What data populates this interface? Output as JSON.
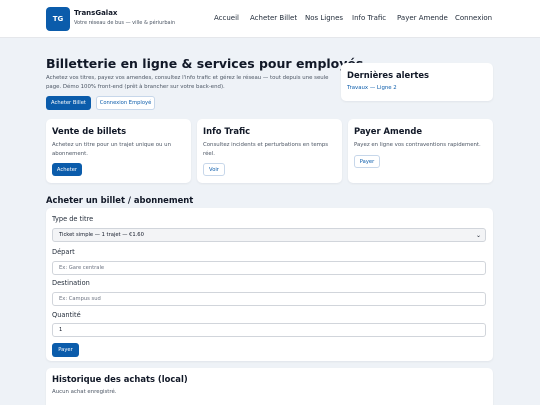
{
  "header": {
    "logo_text": "TG",
    "brand_name": "TransGalax",
    "tagline": "Votre réseau de bus — ville & périurbain",
    "nav": [
      "Accueil",
      "Acheter Billet",
      "Nos Lignes",
      "Info Trafic",
      "Payer Amende",
      "Connexion"
    ]
  },
  "hero": {
    "title": "Billetterie en ligne & services pour employés",
    "description": "Achetez vos titres, payez vos amendes, consultez l'info trafic et gérez le réseau — tout depuis une seule page. Démo 100% front-end (prêt à brancher sur votre back-end).",
    "primary_button": "Acheter Billet",
    "secondary_button": "Connexion Employé"
  },
  "alerts": {
    "title": "Dernières alertes",
    "items": [
      "Travaux — Ligne 2"
    ]
  },
  "cards": [
    {
      "title": "Vente de billets",
      "description": "Achetez un titre pour un trajet unique ou un abonnement.",
      "button": "Acheter"
    },
    {
      "title": "Info Trafic",
      "description": "Consultez incidents et perturbations en temps réel.",
      "button": "Voir"
    },
    {
      "title": "Payer Amende",
      "description": "Payez en ligne vos contraventions rapidement.",
      "button": "Payer"
    }
  ],
  "purchase": {
    "section_title": "Acheter un billet / abonnement",
    "type_label": "Type de titre",
    "type_value": "Ticket simple — 1 trajet — €1.60",
    "departure_label": "Départ",
    "departure_placeholder": "Ex: Gare centrale",
    "destination_label": "Destination",
    "destination_placeholder": "Ex: Campus sud",
    "quantity_label": "Quantité",
    "quantity_value": "1",
    "pay_button": "Payer"
  },
  "history": {
    "title": "Historique des achats (local)",
    "empty_text": "Aucun achat enregistré."
  }
}
